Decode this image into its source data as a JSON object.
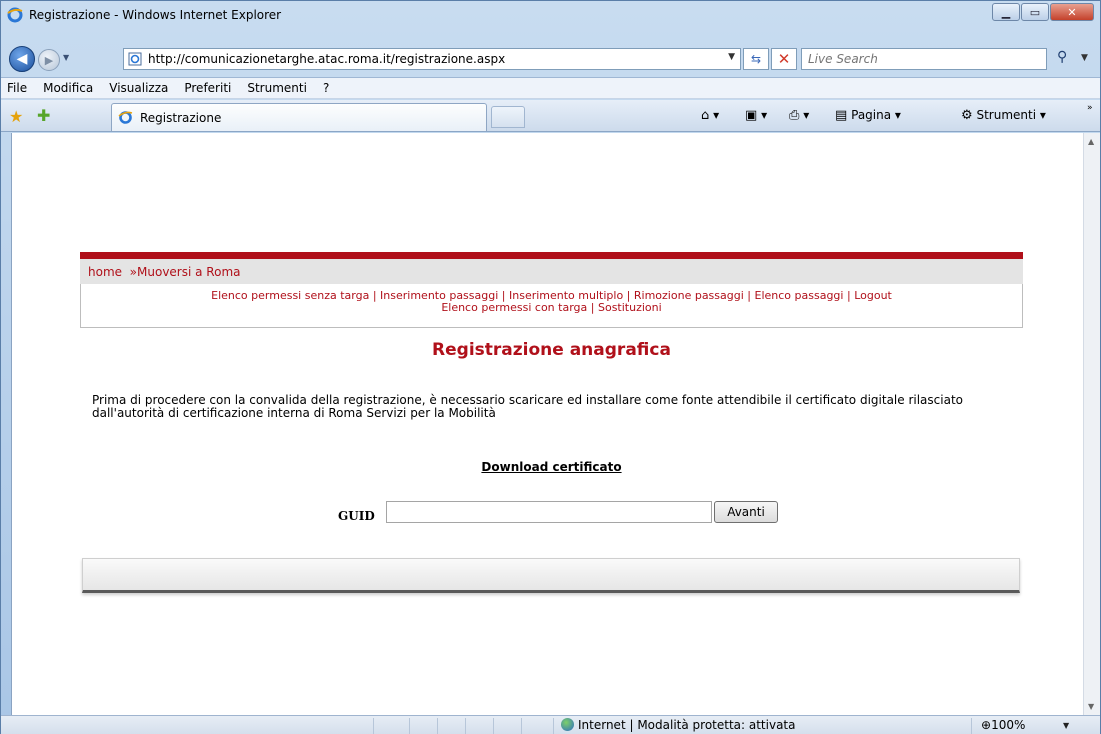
{
  "window": {
    "title": "Registrazione - Windows Internet Explorer"
  },
  "address": {
    "url": "http://comunicazionetarghe.atac.roma.it/registrazione.aspx"
  },
  "search": {
    "placeholder": "Live Search"
  },
  "menu": {
    "file": "File",
    "modifica": "Modifica",
    "visualizza": "Visualizza",
    "preferiti": "Preferiti",
    "strumenti": "Strumenti",
    "help": "?"
  },
  "tab": {
    "label": "Registrazione"
  },
  "commandbar": {
    "pagina": "Pagina",
    "strumenti": "Strumenti"
  },
  "breadcrumb": {
    "home": "home",
    "separator": "»",
    "section": "Muoversi a Roma"
  },
  "links": {
    "row1": [
      "Elenco permessi senza targa",
      "Inserimento passaggi",
      "Inserimento multiplo",
      "Rimozione passaggi",
      "Elenco passaggi",
      "Logout"
    ],
    "row2": [
      "Elenco permessi con targa",
      "Sostituzioni"
    ],
    "pipe": "|"
  },
  "page": {
    "heading": "Registrazione anagrafica",
    "paragraph": "Prima di procedere con la convalida della registrazione, è necessario scaricare ed installare come fonte attendibile il certificato digitale rilasciato dall'autorità di certificazione interna di Roma Servizi per la Mobilità",
    "download_link": "Download certificato",
    "guid_label": "GUID",
    "guid_value": "",
    "submit_label": "Avanti"
  },
  "status": {
    "zone": "Internet | Modalità protetta: attivata",
    "zoom": "100%"
  },
  "colors": {
    "brand_red": "#b0101a",
    "frame_blue": "#b9d1ea"
  }
}
